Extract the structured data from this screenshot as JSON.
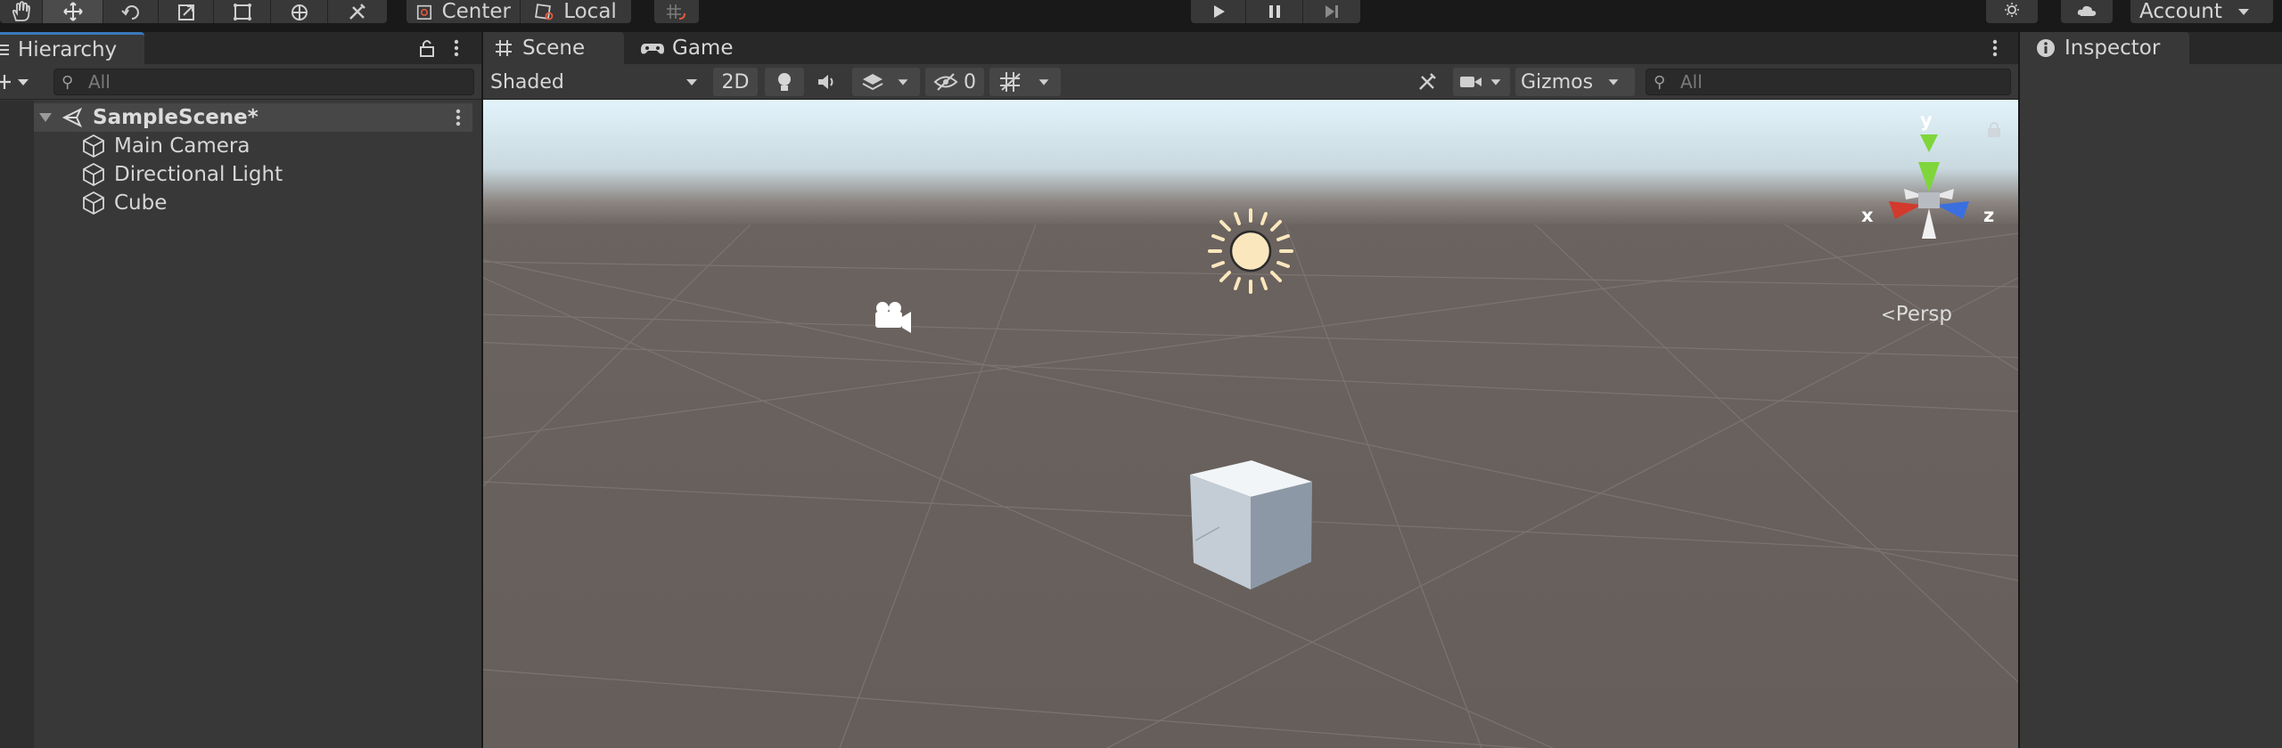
{
  "toolbar": {
    "tools": [
      "hand-tool",
      "move-tool",
      "rotate-tool",
      "scale-tool",
      "rect-tool",
      "transform-tool",
      "custom-tool"
    ],
    "pivot_label": "Center",
    "space_label": "Local",
    "account_label": "Account"
  },
  "hierarchy": {
    "tab_label": "Hierarchy",
    "search_placeholder": "All",
    "scene_name": "SampleScene*",
    "objects": [
      "Main Camera",
      "Directional Light",
      "Cube"
    ]
  },
  "scene_view": {
    "tabs": [
      {
        "label": "Scene",
        "icon": "grid-icon",
        "active": true
      },
      {
        "label": "Game",
        "icon": "gamepad-icon",
        "active": false
      }
    ],
    "draw_mode": "Shaded",
    "toggle_2d": "2D",
    "hidden_count": "0",
    "gizmos_label": "Gizmos",
    "search_placeholder": "All",
    "projection_label": "Persp",
    "axis_labels": {
      "x": "x",
      "y": "y",
      "z": "z"
    }
  },
  "inspector": {
    "tab_label": "Inspector"
  },
  "colors": {
    "accent": "#3a79bb",
    "panel": "#383838",
    "header": "#282828",
    "ground": "#6a625e",
    "sky_top": "#e6f4fb",
    "axis_x": "#d23a2c",
    "axis_y": "#7ed63b",
    "axis_z": "#3b6fe0"
  }
}
